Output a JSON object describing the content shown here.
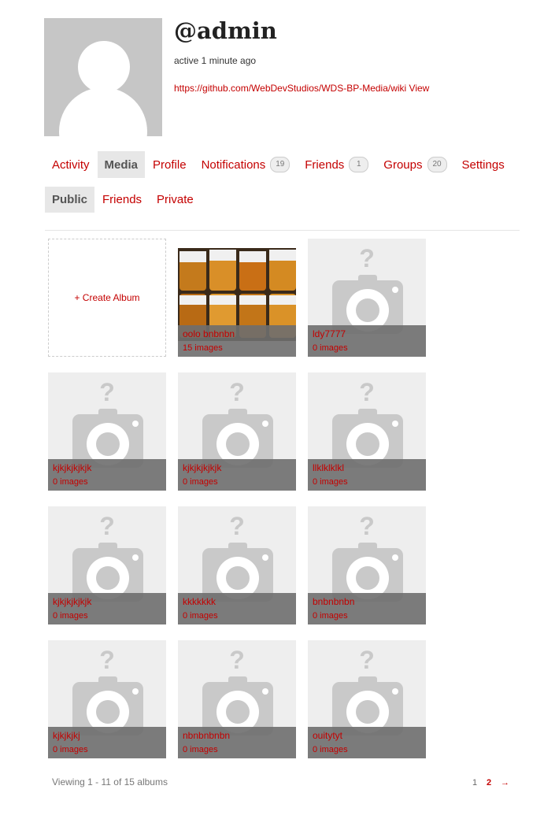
{
  "profile": {
    "handle": "@admin",
    "activity": "active 1 minute ago",
    "link": "https://github.com/WebDevStudios/WDS-BP-Media/wiki View"
  },
  "nav": [
    {
      "label": "Activity"
    },
    {
      "label": "Media",
      "selected": true
    },
    {
      "label": "Profile"
    },
    {
      "label": "Notifications",
      "count": "19"
    },
    {
      "label": "Friends",
      "count": "1"
    },
    {
      "label": "Groups",
      "count": "20"
    },
    {
      "label": "Settings"
    }
  ],
  "subnav": [
    {
      "label": "Public",
      "selected": true
    },
    {
      "label": "Friends"
    },
    {
      "label": "Private"
    }
  ],
  "create_album": "+ Create Album",
  "albums": [
    {
      "name": "oolo bnbnbn",
      "count": "15 images",
      "photo": true
    },
    {
      "name": "ldy7777",
      "count": "0 images"
    },
    {
      "name": "kjkjkjkjkjk",
      "count": "0 images"
    },
    {
      "name": "kjkjkjkjkjk",
      "count": "0 images"
    },
    {
      "name": "llklklklkl",
      "count": "0 images"
    },
    {
      "name": "kjkjkjkjkjk",
      "count": "0 images"
    },
    {
      "name": "kkkkkkk",
      "count": "0 images"
    },
    {
      "name": "bnbnbnbn",
      "count": "0 images"
    },
    {
      "name": "kjkjkjkj",
      "count": "0 images"
    },
    {
      "name": "nbnbnbnbn",
      "count": "0 images"
    },
    {
      "name": "ouitytyt",
      "count": "0 images"
    }
  ],
  "footer": {
    "viewing": "Viewing 1 - 11 of 15 albums",
    "pages": [
      "1",
      "2"
    ],
    "next": "→"
  },
  "colors": {
    "accent": "#c40000",
    "placeholder": "#eeeeee",
    "caption_bg": "#6e6e6e"
  }
}
